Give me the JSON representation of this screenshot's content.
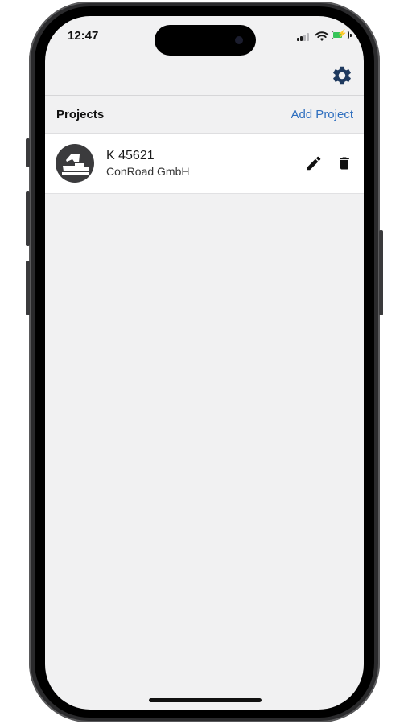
{
  "status_bar": {
    "time": "12:47",
    "signal_icon": "cellular-signal-icon",
    "wifi_icon": "wifi-icon",
    "battery_icon": "battery-charging-icon",
    "battery_level": 0.55
  },
  "nav_bar": {
    "settings_icon": "gear-icon"
  },
  "colors": {
    "accent": "#2f6fbf",
    "gear": "#1f3a5f",
    "background": "#f1f1f2"
  },
  "section": {
    "title": "Projects",
    "add_label": "Add Project"
  },
  "projects": [
    {
      "name": "K 45621",
      "company": "ConRoad GmbH",
      "avatar_icon": "paver-machine-icon",
      "edit_icon": "pencil-icon",
      "delete_icon": "trash-icon"
    }
  ]
}
